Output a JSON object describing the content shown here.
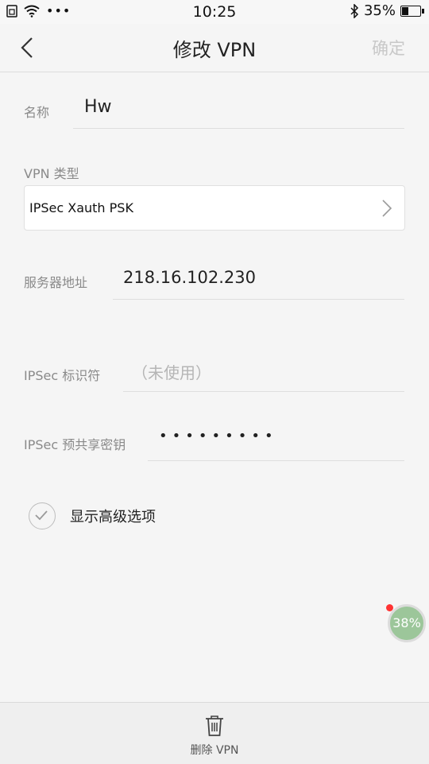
{
  "status_bar": {
    "time": "10:25",
    "battery": "35%",
    "battery_level": 0.35,
    "icons": [
      "sim-icon",
      "wifi-icon",
      "more-dots-icon",
      "bluetooth-icon",
      "battery-icon"
    ]
  },
  "header": {
    "title": "修改 VPN",
    "confirm": "确定"
  },
  "form": {
    "name": {
      "label": "名称",
      "value": "Hw"
    },
    "vpn_type": {
      "label": "VPN 类型",
      "value": "IPSec Xauth PSK"
    },
    "server": {
      "label": "服务器地址",
      "value": "218.16.102.230"
    },
    "ipsec_id": {
      "label": "IPSec 标识符",
      "placeholder": "（未使用）"
    },
    "psk": {
      "label": "IPSec 预共享密钥",
      "value": "•••••••••"
    },
    "advanced": {
      "label": "显示高级选项",
      "checked": false
    }
  },
  "float_ball": {
    "text": "38%"
  },
  "bottom": {
    "delete_label": "删除 VPN"
  },
  "colors": {
    "placeholder": "#b5b5b5",
    "confirm_disabled": "#c8c8c8",
    "float_ball": "#9cc69a"
  }
}
